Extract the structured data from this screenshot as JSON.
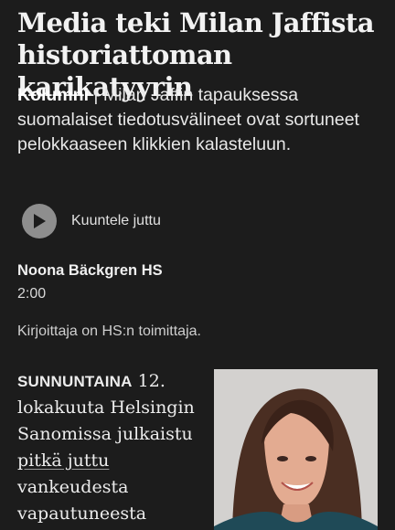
{
  "article": {
    "headline": "Media teki Milan Jaffista historiattoman karikatyyrin",
    "kicker": "Kolumni",
    "separator": " | ",
    "lead": "Milan Jaffin tapauksessa suomalaiset tiedotusvälineet ovat sortuneet pelokkaaseen klikkien kalasteluun.",
    "listen_label": "Kuuntele juttu",
    "author": "Noona Bäckgren HS",
    "time": "2:00",
    "author_note": "Kirjoittaja on HS:n toimittaja.",
    "body_caps": "SUNNUNTAINA",
    "body_before_link": " 12. lokakuuta Helsingin Sanomissa julkaistu ",
    "body_link": "pitkä juttu",
    "body_after_link": " vankeudesta vapautuneesta"
  },
  "icons": {
    "play": "play-icon"
  },
  "colors": {
    "background": "#1c1c1c",
    "text": "#ececec",
    "play_button": "#8e8e8e",
    "photo_background": "#d3d1cf"
  }
}
